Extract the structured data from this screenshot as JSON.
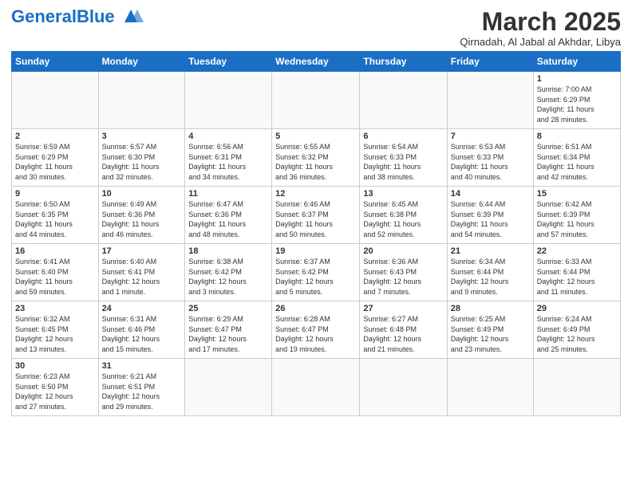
{
  "header": {
    "logo_general": "General",
    "logo_blue": "Blue",
    "month": "March 2025",
    "location": "Qirnadah, Al Jabal al Akhdar, Libya"
  },
  "weekdays": [
    "Sunday",
    "Monday",
    "Tuesday",
    "Wednesday",
    "Thursday",
    "Friday",
    "Saturday"
  ],
  "weeks": [
    [
      {
        "day": "",
        "info": ""
      },
      {
        "day": "",
        "info": ""
      },
      {
        "day": "",
        "info": ""
      },
      {
        "day": "",
        "info": ""
      },
      {
        "day": "",
        "info": ""
      },
      {
        "day": "",
        "info": ""
      },
      {
        "day": "1",
        "info": "Sunrise: 7:00 AM\nSunset: 6:29 PM\nDaylight: 11 hours\nand 28 minutes."
      }
    ],
    [
      {
        "day": "2",
        "info": "Sunrise: 6:59 AM\nSunset: 6:29 PM\nDaylight: 11 hours\nand 30 minutes."
      },
      {
        "day": "3",
        "info": "Sunrise: 6:57 AM\nSunset: 6:30 PM\nDaylight: 11 hours\nand 32 minutes."
      },
      {
        "day": "4",
        "info": "Sunrise: 6:56 AM\nSunset: 6:31 PM\nDaylight: 11 hours\nand 34 minutes."
      },
      {
        "day": "5",
        "info": "Sunrise: 6:55 AM\nSunset: 6:32 PM\nDaylight: 11 hours\nand 36 minutes."
      },
      {
        "day": "6",
        "info": "Sunrise: 6:54 AM\nSunset: 6:33 PM\nDaylight: 11 hours\nand 38 minutes."
      },
      {
        "day": "7",
        "info": "Sunrise: 6:53 AM\nSunset: 6:33 PM\nDaylight: 11 hours\nand 40 minutes."
      },
      {
        "day": "8",
        "info": "Sunrise: 6:51 AM\nSunset: 6:34 PM\nDaylight: 11 hours\nand 42 minutes."
      }
    ],
    [
      {
        "day": "9",
        "info": "Sunrise: 6:50 AM\nSunset: 6:35 PM\nDaylight: 11 hours\nand 44 minutes."
      },
      {
        "day": "10",
        "info": "Sunrise: 6:49 AM\nSunset: 6:36 PM\nDaylight: 11 hours\nand 46 minutes."
      },
      {
        "day": "11",
        "info": "Sunrise: 6:47 AM\nSunset: 6:36 PM\nDaylight: 11 hours\nand 48 minutes."
      },
      {
        "day": "12",
        "info": "Sunrise: 6:46 AM\nSunset: 6:37 PM\nDaylight: 11 hours\nand 50 minutes."
      },
      {
        "day": "13",
        "info": "Sunrise: 6:45 AM\nSunset: 6:38 PM\nDaylight: 11 hours\nand 52 minutes."
      },
      {
        "day": "14",
        "info": "Sunrise: 6:44 AM\nSunset: 6:39 PM\nDaylight: 11 hours\nand 54 minutes."
      },
      {
        "day": "15",
        "info": "Sunrise: 6:42 AM\nSunset: 6:39 PM\nDaylight: 11 hours\nand 57 minutes."
      }
    ],
    [
      {
        "day": "16",
        "info": "Sunrise: 6:41 AM\nSunset: 6:40 PM\nDaylight: 11 hours\nand 59 minutes."
      },
      {
        "day": "17",
        "info": "Sunrise: 6:40 AM\nSunset: 6:41 PM\nDaylight: 12 hours\nand 1 minute."
      },
      {
        "day": "18",
        "info": "Sunrise: 6:38 AM\nSunset: 6:42 PM\nDaylight: 12 hours\nand 3 minutes."
      },
      {
        "day": "19",
        "info": "Sunrise: 6:37 AM\nSunset: 6:42 PM\nDaylight: 12 hours\nand 5 minutes."
      },
      {
        "day": "20",
        "info": "Sunrise: 6:36 AM\nSunset: 6:43 PM\nDaylight: 12 hours\nand 7 minutes."
      },
      {
        "day": "21",
        "info": "Sunrise: 6:34 AM\nSunset: 6:44 PM\nDaylight: 12 hours\nand 9 minutes."
      },
      {
        "day": "22",
        "info": "Sunrise: 6:33 AM\nSunset: 6:44 PM\nDaylight: 12 hours\nand 11 minutes."
      }
    ],
    [
      {
        "day": "23",
        "info": "Sunrise: 6:32 AM\nSunset: 6:45 PM\nDaylight: 12 hours\nand 13 minutes."
      },
      {
        "day": "24",
        "info": "Sunrise: 6:31 AM\nSunset: 6:46 PM\nDaylight: 12 hours\nand 15 minutes."
      },
      {
        "day": "25",
        "info": "Sunrise: 6:29 AM\nSunset: 6:47 PM\nDaylight: 12 hours\nand 17 minutes."
      },
      {
        "day": "26",
        "info": "Sunrise: 6:28 AM\nSunset: 6:47 PM\nDaylight: 12 hours\nand 19 minutes."
      },
      {
        "day": "27",
        "info": "Sunrise: 6:27 AM\nSunset: 6:48 PM\nDaylight: 12 hours\nand 21 minutes."
      },
      {
        "day": "28",
        "info": "Sunrise: 6:25 AM\nSunset: 6:49 PM\nDaylight: 12 hours\nand 23 minutes."
      },
      {
        "day": "29",
        "info": "Sunrise: 6:24 AM\nSunset: 6:49 PM\nDaylight: 12 hours\nand 25 minutes."
      }
    ],
    [
      {
        "day": "30",
        "info": "Sunrise: 6:23 AM\nSunset: 6:50 PM\nDaylight: 12 hours\nand 27 minutes."
      },
      {
        "day": "31",
        "info": "Sunrise: 6:21 AM\nSunset: 6:51 PM\nDaylight: 12 hours\nand 29 minutes."
      },
      {
        "day": "",
        "info": ""
      },
      {
        "day": "",
        "info": ""
      },
      {
        "day": "",
        "info": ""
      },
      {
        "day": "",
        "info": ""
      },
      {
        "day": "",
        "info": ""
      }
    ]
  ]
}
